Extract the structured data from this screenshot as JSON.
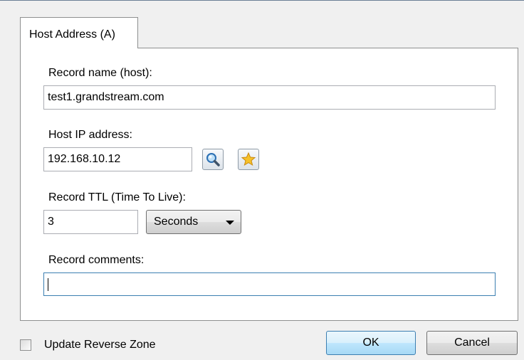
{
  "dialog": {
    "tab_label": "Host Address (A)",
    "record_name": {
      "label": "Record name (host):",
      "value": "test1.grandstream.com"
    },
    "host_ip": {
      "label": "Host IP address:",
      "value": "192.168.10.12",
      "icons": [
        "search-icon",
        "star-icon"
      ]
    },
    "ttl": {
      "label": "Record TTL (Time To Live):",
      "value": "3",
      "unit": "Seconds"
    },
    "comments": {
      "label": "Record comments:",
      "value": ""
    }
  },
  "footer": {
    "checkbox_label": "Update Reverse Zone",
    "checkbox_checked": false,
    "ok_label": "OK",
    "cancel_label": "Cancel"
  },
  "colors": {
    "accent_border": "#3c7fb1",
    "ok_button_top": "#eaf6fd",
    "ok_button_bottom": "#a7d9f5",
    "star_fill": "#f6c12a",
    "magnifier_lens": "#3a8fd8"
  }
}
